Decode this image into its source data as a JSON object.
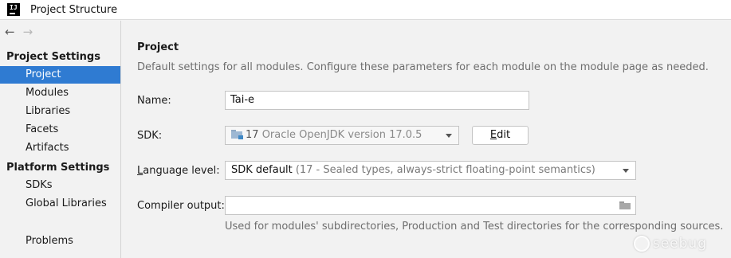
{
  "window": {
    "title": "Project Structure",
    "logo": "intellij-idea-logo"
  },
  "nav": {
    "back_icon": "←",
    "forward_icon": "→"
  },
  "sidebar": {
    "project_settings_header": "Project Settings",
    "project_items": [
      "Project",
      "Modules",
      "Libraries",
      "Facets",
      "Artifacts"
    ],
    "platform_settings_header": "Platform Settings",
    "platform_items": [
      "SDKs",
      "Global Libraries"
    ],
    "problems": "Problems",
    "selected": "Project"
  },
  "main": {
    "title": "Project",
    "description": "Default settings for all modules. Configure these parameters for each module on the module page as needed.",
    "name_label": "Name:",
    "name_value": "Tai-e",
    "sdk_label": "SDK:",
    "sdk_version": "17",
    "sdk_name": "Oracle OpenJDK version 17.0.5",
    "edit_button": "Edit",
    "language_label_prefix": "L",
    "language_label_rest": "anguage level:",
    "language_value": "SDK default",
    "language_detail": "(17 - Sealed types, always-strict floating-point semantics)",
    "compiler_label": "Compiler output:",
    "compiler_value": "",
    "compiler_hint": "Used for modules' subdirectories, Production and Test directories for the corresponding sources."
  },
  "watermark": "seebug",
  "colors": {
    "selection": "#2f7bd2",
    "background": "#f2f2f2"
  }
}
